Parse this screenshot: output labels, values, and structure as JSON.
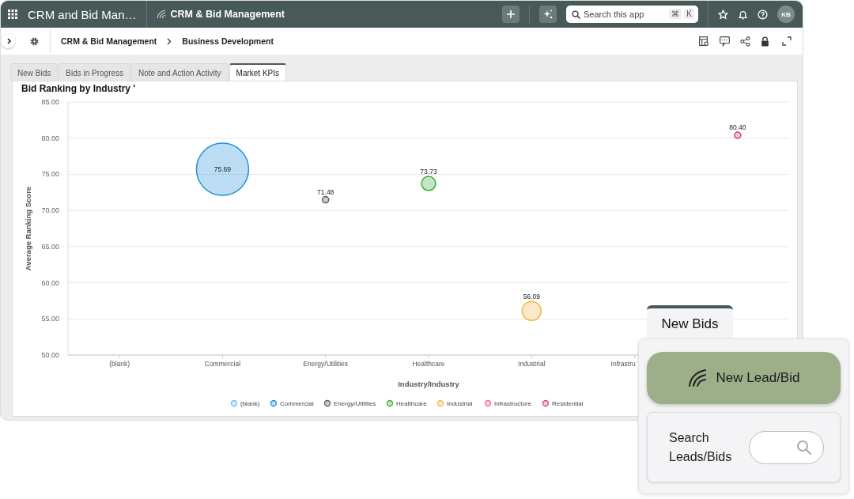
{
  "app_bar": {
    "app_name": "CRM and Bid Man…",
    "module": "CRM & Bid Management",
    "search": {
      "placeholder": "Search this app",
      "shortcut": [
        "⌘",
        "K"
      ]
    },
    "avatar": "KB"
  },
  "breadcrumbs": [
    "CRM & Bid Management",
    "Business Development"
  ],
  "tabs": [
    {
      "label": "New Bids",
      "selected": false
    },
    {
      "label": "Bids in Progress",
      "selected": false
    },
    {
      "label": "Note and Action Activity",
      "selected": false
    },
    {
      "label": "Market KPIs",
      "selected": true
    }
  ],
  "chart_card": {
    "title": "Bid Ranking by Industry '",
    "chart_data": {
      "type": "scatter",
      "xlabel": "Industry/Industry",
      "ylabel": "Average Ranking Score",
      "categories": [
        "(blank)",
        "Commercial",
        "Energy/Utilities",
        "Healthcare",
        "Industrial",
        "Infrastru",
        null
      ],
      "ylim": [
        50,
        85
      ],
      "yticks": [
        {
          "value": 50,
          "label": "50.00"
        },
        {
          "value": 55,
          "label": "55.00"
        },
        {
          "value": 60,
          "label": "60.00"
        },
        {
          "value": 65,
          "label": "65.00"
        },
        {
          "value": 70,
          "label": "70.00"
        },
        {
          "value": 75,
          "label": "75.00"
        },
        {
          "value": 80,
          "label": "80.00"
        },
        {
          "value": 85,
          "label": "85.00"
        }
      ],
      "grid": true,
      "legend": "bottom",
      "value_labels": [
        "75.69",
        "71.48",
        "73.73",
        "56.09",
        "80.40"
      ],
      "series": [
        {
          "name": "(blank)",
          "color": "#6cc0ec",
          "values": [
            null,
            null,
            null,
            null,
            null,
            null,
            null
          ]
        },
        {
          "name": "Commercial",
          "color": "#2190d8",
          "values": [
            null,
            75.69,
            null,
            null,
            null,
            null,
            null
          ]
        },
        {
          "name": "Energy/Utilities",
          "color": "#5a5a5a",
          "values": [
            null,
            null,
            71.48,
            null,
            null,
            null,
            null
          ]
        },
        {
          "name": "Healthcare",
          "color": "#3ca83a",
          "values": [
            null,
            null,
            null,
            73.73,
            null,
            null,
            null
          ]
        },
        {
          "name": "Industrial",
          "color": "#f5b54a",
          "values": [
            null,
            null,
            null,
            null,
            56.09,
            null,
            null
          ]
        },
        {
          "name": "Infrastructure",
          "color": "#ea6f86",
          "values": [
            null,
            null,
            null,
            null,
            null,
            null,
            null
          ]
        },
        {
          "name": "Residential",
          "color": "#d6407e",
          "values": [
            null,
            null,
            null,
            null,
            null,
            null,
            80.4
          ]
        }
      ]
    }
  },
  "quick_panel": {
    "tab": "New Bids",
    "action": "New Lead/Bid",
    "search_label": "Search Leads/Bids"
  }
}
